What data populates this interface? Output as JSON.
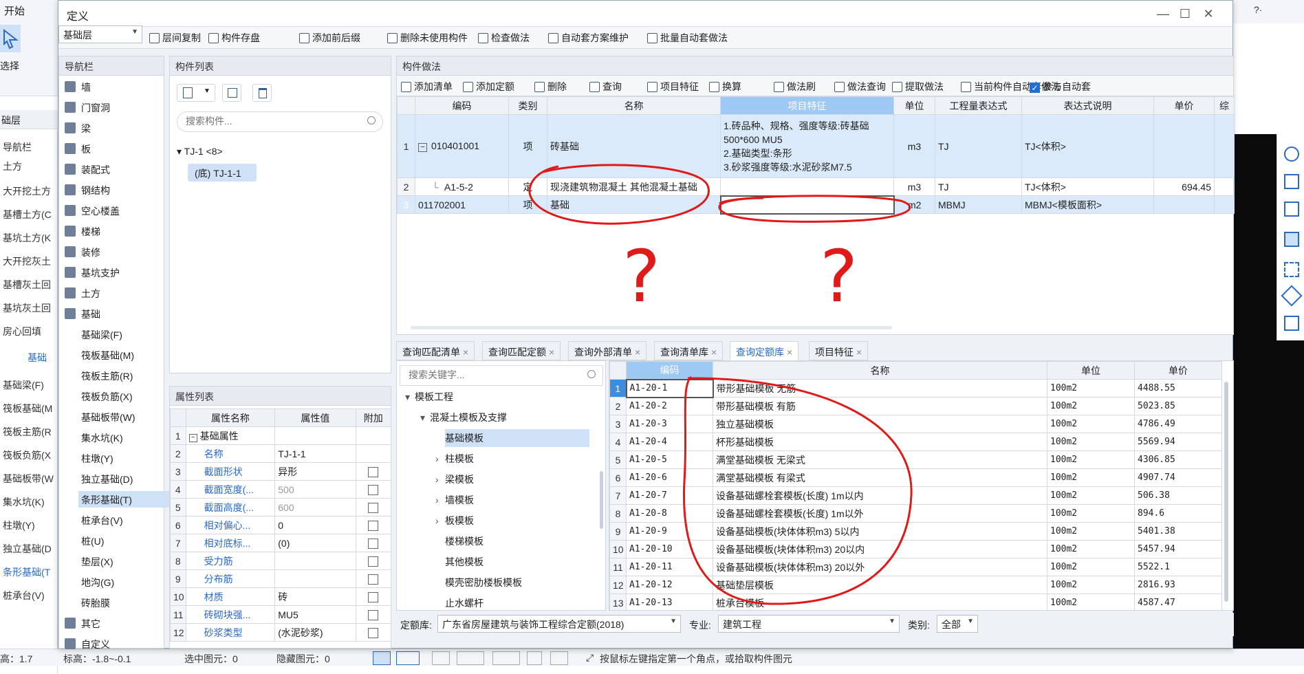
{
  "background": {
    "ribbon": {
      "start_tab": "开始",
      "select_label": "选择"
    },
    "left_panel": {
      "header": "础层",
      "nav_title": "导航栏",
      "items": [
        "土方",
        "大开挖土方",
        "基槽土方(C",
        "基坑土方(K",
        "大开挖灰土",
        "基槽灰土回",
        "基坑灰土回",
        "房心回填",
        "基础",
        "基础梁(F)",
        "筏板基础(M",
        "筏板主筋(R",
        "筏板负筋(X",
        "基础板带(W",
        "集水坑(K)",
        "柱墩(Y)",
        "独立基础(D",
        "条形基础(T",
        "桩承台(V)"
      ]
    },
    "statusbar": {
      "floor": "高：1.7",
      "elev": "标高：-1.8~-0.1",
      "selected": "选中图元：0",
      "hidden": "隐藏图元：0",
      "hint": "按鼠标左键指定第一个角点，或拾取构件图元"
    },
    "top_right": "?·"
  },
  "dialog": {
    "title": "定义",
    "floor_select": "基础层",
    "toolbar": [
      "层间复制",
      "构件存盘",
      "添加前后缀",
      "删除未使用构件",
      "检查做法",
      "自动套方案维护",
      "批量自动套做法"
    ]
  },
  "nav": {
    "title": "导航栏",
    "items": [
      {
        "label": "墙",
        "level": 0
      },
      {
        "label": "门窗洞",
        "level": 0
      },
      {
        "label": "梁",
        "level": 0
      },
      {
        "label": "板",
        "level": 0
      },
      {
        "label": "装配式",
        "level": 0
      },
      {
        "label": "钢结构",
        "level": 0
      },
      {
        "label": "空心楼盖",
        "level": 0
      },
      {
        "label": "楼梯",
        "level": 0
      },
      {
        "label": "装修",
        "level": 0
      },
      {
        "label": "基坑支护",
        "level": 0
      },
      {
        "label": "土方",
        "level": 0
      },
      {
        "label": "基础",
        "level": 0
      },
      {
        "label": "基础梁(F)",
        "level": 1
      },
      {
        "label": "筏板基础(M)",
        "level": 1
      },
      {
        "label": "筏板主筋(R)",
        "level": 1
      },
      {
        "label": "筏板负筋(X)",
        "level": 1
      },
      {
        "label": "基础板带(W)",
        "level": 1
      },
      {
        "label": "集水坑(K)",
        "level": 1
      },
      {
        "label": "柱墩(Y)",
        "level": 1
      },
      {
        "label": "独立基础(D)",
        "level": 1
      },
      {
        "label": "条形基础(T)",
        "level": 1,
        "selected": true
      },
      {
        "label": "桩承台(V)",
        "level": 1
      },
      {
        "label": "桩(U)",
        "level": 1
      },
      {
        "label": "垫层(X)",
        "level": 1
      },
      {
        "label": "地沟(G)",
        "level": 1
      },
      {
        "label": "砖胎膜",
        "level": 1
      },
      {
        "label": "其它",
        "level": 0
      },
      {
        "label": "自定义",
        "level": 0
      }
    ]
  },
  "component_list": {
    "title": "构件列表",
    "search_placeholder": "搜索构件...",
    "group": "TJ-1 <8>",
    "item": "(底) TJ-1-1"
  },
  "properties": {
    "title": "属性列表",
    "headers": [
      "属性名称",
      "属性值",
      "附加"
    ],
    "rows": [
      {
        "n": "1",
        "name": "基础属性",
        "value": "",
        "group": true
      },
      {
        "n": "2",
        "name": "名称",
        "value": "TJ-1-1",
        "chk": false
      },
      {
        "n": "3",
        "name": "截面形状",
        "value": "异形",
        "chk": true
      },
      {
        "n": "4",
        "name": "截面宽度(...",
        "value": "500",
        "chk": true,
        "gray": true
      },
      {
        "n": "5",
        "name": "截面高度(...",
        "value": "600",
        "chk": true,
        "gray": true
      },
      {
        "n": "6",
        "name": "相对偏心...",
        "value": "0",
        "chk": true
      },
      {
        "n": "7",
        "name": "相对底标...",
        "value": "(0)",
        "chk": true
      },
      {
        "n": "8",
        "name": "受力筋",
        "value": "",
        "chk": true
      },
      {
        "n": "9",
        "name": "分布筋",
        "value": "",
        "chk": true
      },
      {
        "n": "10",
        "name": "材质",
        "value": "砖",
        "chk": true
      },
      {
        "n": "11",
        "name": "砖砌块强...",
        "value": "MU5",
        "chk": true
      },
      {
        "n": "12",
        "name": "砂浆类型",
        "value": "(水泥砂浆)",
        "chk": true
      }
    ]
  },
  "methods": {
    "title": "构件做法",
    "toolbar": [
      "添加清单",
      "添加定额",
      "删除",
      "查询",
      "项目特征",
      "换算",
      "做法刷",
      "做法查询",
      "提取做法",
      "当前构件自动套做法",
      "参与自动套"
    ],
    "headers": [
      "编码",
      "类别",
      "名称",
      "项目特征",
      "单位",
      "工程量表达式",
      "表达式说明",
      "单价",
      "综"
    ],
    "rows": [
      {
        "n": "1",
        "code": "010401001",
        "type": "项",
        "name": "砖基础",
        "feature": [
          "1.砖品种、规格、强度等级:砖基础",
          "500*600 MU5",
          "2.基础类型:条形",
          "3.砂浆强度等级:水泥砂浆M7.5"
        ],
        "unit": "m3",
        "expr": "TJ",
        "desc": "TJ<体积>",
        "price": ""
      },
      {
        "n": "2",
        "code": "A1-5-2",
        "type": "定",
        "name": "现浇建筑物混凝土 其他混凝土基础",
        "feature": [],
        "unit": "m3",
        "expr": "TJ",
        "desc": "TJ<体积>",
        "price": "694.45"
      },
      {
        "n": "3",
        "code": "011702001",
        "type": "项",
        "name": "基础",
        "feature": [],
        "unit": "m2",
        "expr": "MBMJ",
        "desc": "MBMJ<模板面积>",
        "price": ""
      }
    ]
  },
  "bottom_tabs": [
    "查询匹配清单",
    "查询匹配定额",
    "查询外部清单",
    "查询清单库",
    "查询定额库",
    "项目特征"
  ],
  "quota_tree": {
    "search_placeholder": "搜索关键字...",
    "items": [
      {
        "label": "模板工程",
        "level": 0,
        "arrow": "▾"
      },
      {
        "label": "混凝土模板及支撑",
        "level": 1,
        "arrow": "▾"
      },
      {
        "label": "基础模板",
        "level": 2,
        "arrow": "",
        "selected": true
      },
      {
        "label": "柱模板",
        "level": 2,
        "arrow": "›"
      },
      {
        "label": "梁模板",
        "level": 2,
        "arrow": "›"
      },
      {
        "label": "墙模板",
        "level": 2,
        "arrow": "›"
      },
      {
        "label": "板模板",
        "level": 2,
        "arrow": "›"
      },
      {
        "label": "楼梯模板",
        "level": 2,
        "arrow": ""
      },
      {
        "label": "其他模板",
        "level": 2,
        "arrow": ""
      },
      {
        "label": "模壳密肋楼板模板",
        "level": 2,
        "arrow": ""
      },
      {
        "label": "止水螺杆",
        "level": 2,
        "arrow": ""
      }
    ]
  },
  "quota_table": {
    "headers": [
      "编码",
      "名称",
      "单位",
      "单价"
    ],
    "rows": [
      [
        "1",
        "A1-20-1",
        "带形基础模板 无筋",
        "100m2",
        "4488.55"
      ],
      [
        "2",
        "A1-20-2",
        "带形基础模板 有筋",
        "100m2",
        "5023.85"
      ],
      [
        "3",
        "A1-20-3",
        "独立基础模板",
        "100m2",
        "4786.49"
      ],
      [
        "4",
        "A1-20-4",
        "杯形基础模板",
        "100m2",
        "5569.94"
      ],
      [
        "5",
        "A1-20-5",
        "满堂基础模板 无梁式",
        "100m2",
        "4306.85"
      ],
      [
        "6",
        "A1-20-6",
        "满堂基础模板 有梁式",
        "100m2",
        "4907.74"
      ],
      [
        "7",
        "A1-20-7",
        "设备基础螺栓套模板(长度) 1m以内",
        "100m2",
        "506.38"
      ],
      [
        "8",
        "A1-20-8",
        "设备基础螺栓套模板(长度) 1m以外",
        "100m2",
        "894.6"
      ],
      [
        "9",
        "A1-20-9",
        "设备基础模板(块体体积m3) 5以内",
        "100m2",
        "5401.38"
      ],
      [
        "10",
        "A1-20-10",
        "设备基础模板(块体体积m3) 20以内",
        "100m2",
        "5457.94"
      ],
      [
        "11",
        "A1-20-11",
        "设备基础模板(块体体积m3) 20以外",
        "100m2",
        "5522.1"
      ],
      [
        "12",
        "A1-20-12",
        "基础垫层模板",
        "100m2",
        "2816.93"
      ],
      [
        "13",
        "A1-20-13",
        "桩承台模板",
        "100m2",
        "4587.47"
      ]
    ]
  },
  "footer": {
    "library_label": "定额库:",
    "library_value": "广东省房屋建筑与装饰工程综合定额(2018)",
    "major_label": "专业:",
    "major_value": "建筑工程",
    "category_label": "类别:",
    "category_value": "全部"
  },
  "annotations": {
    "question_mark": "?"
  }
}
